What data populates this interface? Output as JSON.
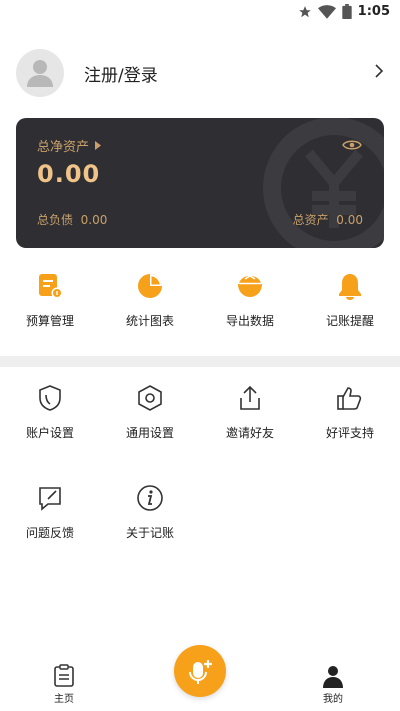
{
  "status_bar": {
    "time": "1:05",
    "icons": [
      "star-icon",
      "wifi-icon",
      "battery-icon"
    ]
  },
  "profile": {
    "login_label": "注册/登录"
  },
  "asset_card": {
    "net_assets_label": "总净资产",
    "net_assets_value": "0.00",
    "debt_label": "总负债",
    "debt_value": "0.00",
    "total_label": "总资产",
    "total_value": "0.00"
  },
  "quick_actions": [
    {
      "label": "预算管理",
      "icon": "budget-icon"
    },
    {
      "label": "统计图表",
      "icon": "pie-chart-icon"
    },
    {
      "label": "导出数据",
      "icon": "export-icon"
    },
    {
      "label": "记账提醒",
      "icon": "bell-icon"
    }
  ],
  "settings": [
    {
      "label": "账户设置",
      "icon": "shield-icon"
    },
    {
      "label": "通用设置",
      "icon": "hexagon-settings-icon"
    },
    {
      "label": "邀请好友",
      "icon": "share-icon"
    },
    {
      "label": "好评支持",
      "icon": "thumbs-up-icon"
    },
    {
      "label": "问题反馈",
      "icon": "feedback-icon"
    },
    {
      "label": "关于记账",
      "icon": "info-icon"
    }
  ],
  "tabbar": {
    "home_label": "主页",
    "mine_label": "我的"
  },
  "colors": {
    "accent": "#f7a11a",
    "card_bg": "#2f2f33",
    "card_text": "#c9a06a",
    "card_value": "#f0c389"
  }
}
